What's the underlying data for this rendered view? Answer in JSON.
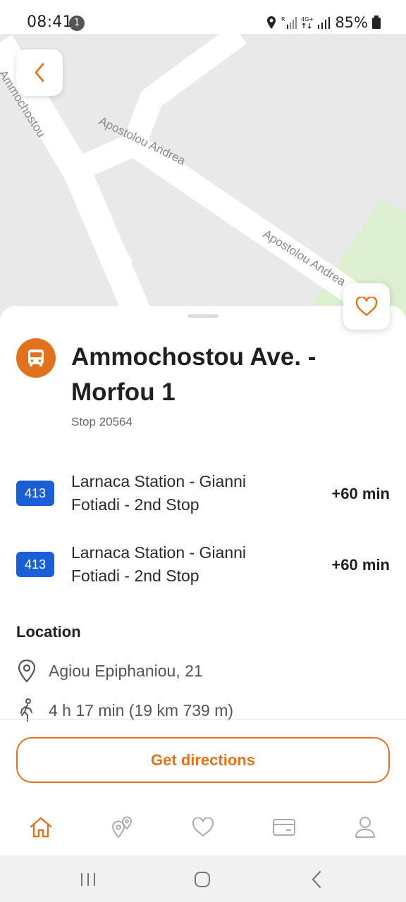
{
  "status_bar": {
    "time": "08:41",
    "notification_count": "1",
    "battery": "85%"
  },
  "map": {
    "street_labels": [
      "Ammochostou",
      "Apostolou Andrea",
      "Apostolou Andrea"
    ]
  },
  "stop": {
    "title": "Ammochostou Ave. - Morfou 1",
    "code": "Stop 20564"
  },
  "routes": [
    {
      "number": "413",
      "name": "Larnaca Station - Gianni Fotiadi - 2nd Stop",
      "eta": "+60 min"
    },
    {
      "number": "413",
      "name": "Larnaca Station - Gianni Fotiadi - 2nd Stop",
      "eta": "+60 min"
    }
  ],
  "location": {
    "heading": "Location",
    "address": "Agiou Epiphaniou, 21",
    "walk": "4 h 17 min (19 km 739 m)"
  },
  "actions": {
    "directions": "Get directions"
  },
  "bottom_nav": {
    "items": [
      "home-icon",
      "map-pins-icon",
      "heart-icon",
      "card-icon",
      "user-icon"
    ],
    "active": "home-icon"
  },
  "colors": {
    "accent": "#e2711d",
    "route_badge": "#1b5fd6",
    "map_bg": "#e9e9e9",
    "road": "#ffffff",
    "park": "#dcefcf"
  }
}
